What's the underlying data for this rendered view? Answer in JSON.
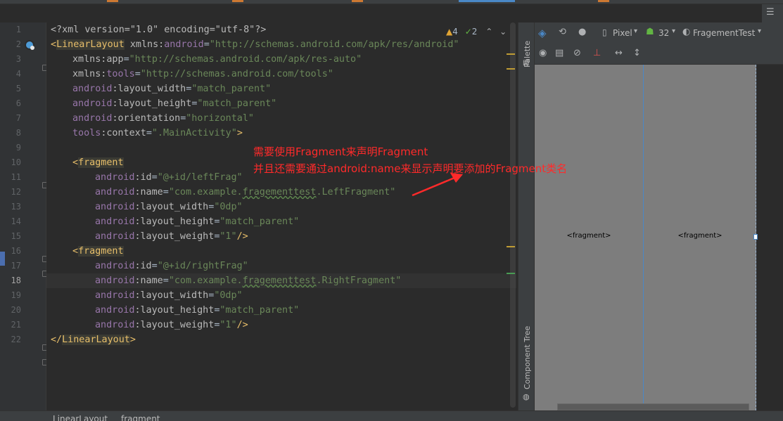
{
  "editor": {
    "line_numbers": [
      "1",
      "2",
      "3",
      "4",
      "5",
      "6",
      "7",
      "8",
      "9",
      "10",
      "11",
      "12",
      "13",
      "14",
      "15",
      "16",
      "17",
      "18",
      "19",
      "20",
      "21",
      "22"
    ],
    "current_line": "18",
    "inspection": {
      "warnings": "4",
      "ok_count": "2"
    },
    "code": {
      "l1": {
        "a": "<?xml version=\"1.0\" encoding=\"utf-8\"?>"
      },
      "l2": {
        "open": "<",
        "tag": "LinearLayout",
        "sp": " ",
        "attr": "xmlns:",
        "ns": "android",
        "eq": "=",
        "val": "\"http://schemas.android.com/apk/res/android\""
      },
      "l3": {
        "attr": "xmlns:app",
        "eq": "=",
        "val": "\"http://schemas.android.com/apk/res-auto\""
      },
      "l4": {
        "attr": "xmlns:",
        "ns": "tools",
        "eq": "=",
        "val": "\"http://schemas.android.com/tools\""
      },
      "l5": {
        "ns": "android",
        "attr": ":layout_width",
        "eq": "=",
        "val": "\"match_parent\""
      },
      "l6": {
        "ns": "android",
        "attr": ":layout_height",
        "eq": "=",
        "val": "\"match_parent\""
      },
      "l7": {
        "ns": "android",
        "attr": ":orientation",
        "eq": "=",
        "val": "\"horizontal\""
      },
      "l8": {
        "ns": "tools",
        "attr": ":context",
        "eq": "=",
        "val": "\".MainActivity\"",
        "close": ">"
      },
      "l10": {
        "open": "<",
        "tag": "fragment"
      },
      "l11": {
        "ns": "android",
        "attr": ":id",
        "eq": "=",
        "val": "\"@+id/leftFrag\""
      },
      "l12": {
        "ns": "android",
        "attr": ":name",
        "eq": "=",
        "val_a": "\"com.example.",
        "val_b": "fragementtest",
        "val_c": ".LeftFragment\""
      },
      "l13": {
        "ns": "android",
        "attr": ":layout_width",
        "eq": "=",
        "val": "\"0dp\""
      },
      "l14": {
        "ns": "android",
        "attr": ":layout_height",
        "eq": "=",
        "val": "\"match_parent\""
      },
      "l15": {
        "ns": "android",
        "attr": ":layout_weight",
        "eq": "=",
        "val": "\"1\"",
        "close": "/>"
      },
      "l16": {
        "open": "<",
        "tag": "fragment"
      },
      "l17": {
        "ns": "android",
        "attr": ":id",
        "eq": "=",
        "val": "\"@+id/rightFrag\""
      },
      "l18": {
        "ns": "android",
        "attr": ":name",
        "eq": "=",
        "val_a": "\"com.example.",
        "val_b": "fragementtest",
        "val_c": ".RightFragment\""
      },
      "l19": {
        "ns": "android",
        "attr": ":layout_width",
        "eq": "=",
        "val": "\"0dp\""
      },
      "l20": {
        "ns": "android",
        "attr": ":layout_height",
        "eq": "=",
        "val": "\"match_parent\""
      },
      "l21": {
        "ns": "android",
        "attr": ":layout_weight",
        "eq": "=",
        "val": "\"1\"",
        "close": "/>"
      },
      "l22": {
        "open": "</",
        "tag": "LinearLayout",
        "close": ">"
      }
    }
  },
  "annotation": {
    "line1": "需要使用Fragment来声明Fragment",
    "line2": "并且还需要通过android:name来显示声明要添加的Fragment类名",
    "color": "#ff2a2a"
  },
  "side_panel": {
    "palette_label": "Palette",
    "component_tree_label": "Component Tree"
  },
  "design_toolbar": {
    "device": "Pixel",
    "api": "32",
    "theme": "FragementTest"
  },
  "canvas": {
    "left_fragment_label": "<fragment>",
    "right_fragment_label": "<fragment>"
  },
  "breadcrumb": [
    "LinearLayout",
    "fragment"
  ],
  "colors": {
    "tag": "#e8bf6a",
    "namespace": "#9876aa",
    "string": "#6a8759",
    "accent": "#4a88c7",
    "warning": "#e0a434"
  }
}
